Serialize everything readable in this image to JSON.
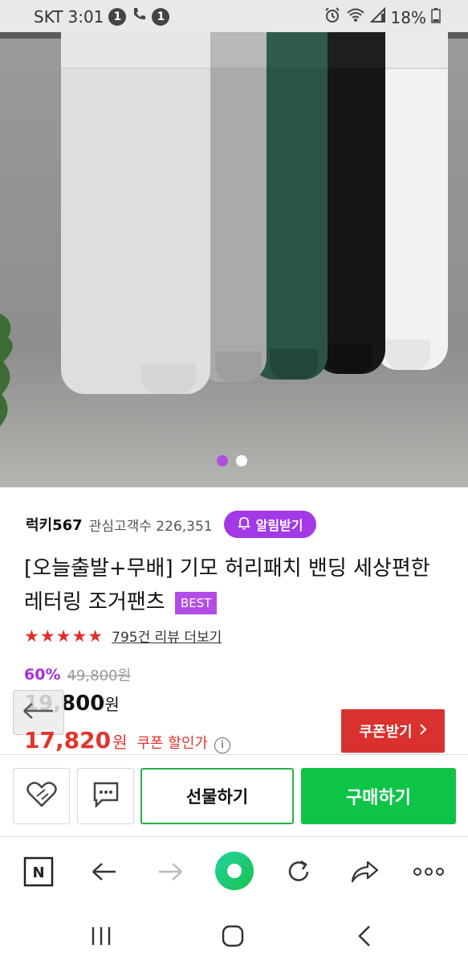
{
  "status_bar": {
    "carrier": "SKT",
    "time": "3:01",
    "badge_1": "1",
    "badge_2": "1",
    "battery": "18%"
  },
  "hero": {
    "carousel_total": 2,
    "carousel_active": 1
  },
  "store": {
    "name": "럭키567",
    "followers": "관심고객수 226,351",
    "alarm_label": "알림받기"
  },
  "product": {
    "title": "[오늘출발+무배] 기모 허리패치 밴딩 세상편한 레터링 조거팬츠",
    "badge": "BEST",
    "stars_text": "★★★★★",
    "rating": 4.5,
    "review_link": "795건 리뷰 더보기",
    "discount_rate": "60%",
    "original_price": "49,800원",
    "sale_price": "19,800",
    "sale_unit": "원",
    "coupon_price": "17,820",
    "coupon_unit": "원",
    "coupon_label": "쿠폰 할인가",
    "info_glyph": "i",
    "coupon_button": "쿠폰받기"
  },
  "actions": {
    "gift": "선물하기",
    "buy": "구매하기"
  },
  "toolbar": {
    "naver_letter": "N"
  },
  "colors": {
    "accent_purple": "#a239e6",
    "buy_green": "#0ec447",
    "coupon_red": "#d9312e"
  }
}
